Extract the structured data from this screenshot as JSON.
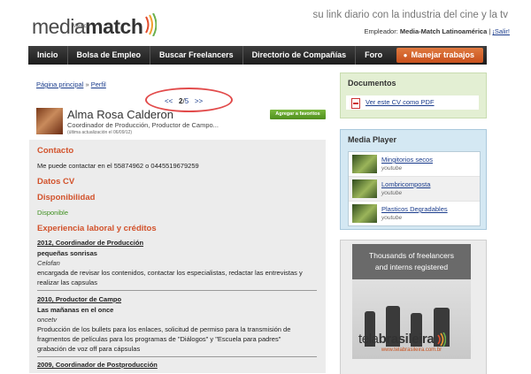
{
  "header": {
    "logo_light": "media",
    "logo_bold": "match",
    "logo_sub": "México",
    "tagline": "su link diario con la industria del cine y la tv",
    "employer_label": "Empleador:",
    "employer_name": "Media-Match Latinoamérica",
    "employer_sep": "|",
    "logout": "¡Salir!"
  },
  "nav": {
    "items": [
      "Inicio",
      "Bolsa de Empleo",
      "Buscar Freelancers",
      "Directorio de Compañías",
      "Foro"
    ],
    "manage": "Manejar trabajos"
  },
  "breadcrumb": {
    "home": "Página principal",
    "sep": "»",
    "current": "Perfil"
  },
  "pager": {
    "prev": "<<",
    "current": "2",
    "slash": "/",
    "total": "5",
    "next": ">>"
  },
  "profile": {
    "name": "Alma Rosa Calderon",
    "role": "Coordinador de Producción, Productor de Campo...",
    "updated": "(última actualización el 06/09/12)",
    "add_favorites": "Agregar a favoritos"
  },
  "sections": {
    "contact_head": "Contacto",
    "contact_text": "Me puede contactar en el 55874962 o 0445519679259",
    "cv_head": "Datos CV",
    "availability_head": "Disponibilidad",
    "availability_value": "Disponible",
    "experience_head": "Experiencia laboral y créditos"
  },
  "experience": [
    {
      "title": "2012, Coordinador de Producción",
      "role": "pequeñas sonrisas",
      "company": "Celofan",
      "desc": [
        "encargada de revisar los contenidos, contactar los especialistas, redactar las entrevistas y",
        "realizar las capsulas"
      ]
    },
    {
      "title": "2010, Productor de Campo",
      "role": "Las mañanas en el once",
      "company": "oncetv",
      "desc": [
        "Producción de los bullets para los enlaces, solicitud de permiso para la transmisión de",
        "fragmentos de películas para los programas de \"Diálogos\" y \"Escuela para padres\"",
        "grabación de voz off para cápsulas"
      ]
    },
    {
      "title": "2009, Coordinador de Postproducción",
      "role": "",
      "company": "",
      "desc": []
    }
  ],
  "documents": {
    "title": "Documentos",
    "pdf_label": "Ver este CV como PDF"
  },
  "media_player": {
    "title": "Media Player",
    "items": [
      {
        "title": "Mingitorios secos",
        "source": "youtube"
      },
      {
        "title": "Lombricomposta",
        "source": "youtube"
      },
      {
        "title": "Plasticos Degradables",
        "source": "youtube"
      }
    ]
  },
  "ad": {
    "line1": "Thousands of freelancers",
    "line2": "and interns registered",
    "brand_light": "tela",
    "brand_bold": "brasileira",
    "url": "www.telabrasileira.com.br"
  },
  "colors": {
    "accent_orange": "#d2522b",
    "green": "#3e8f1f",
    "nav_dark": "#2a2a2a",
    "link_blue": "#1a3c8c"
  }
}
